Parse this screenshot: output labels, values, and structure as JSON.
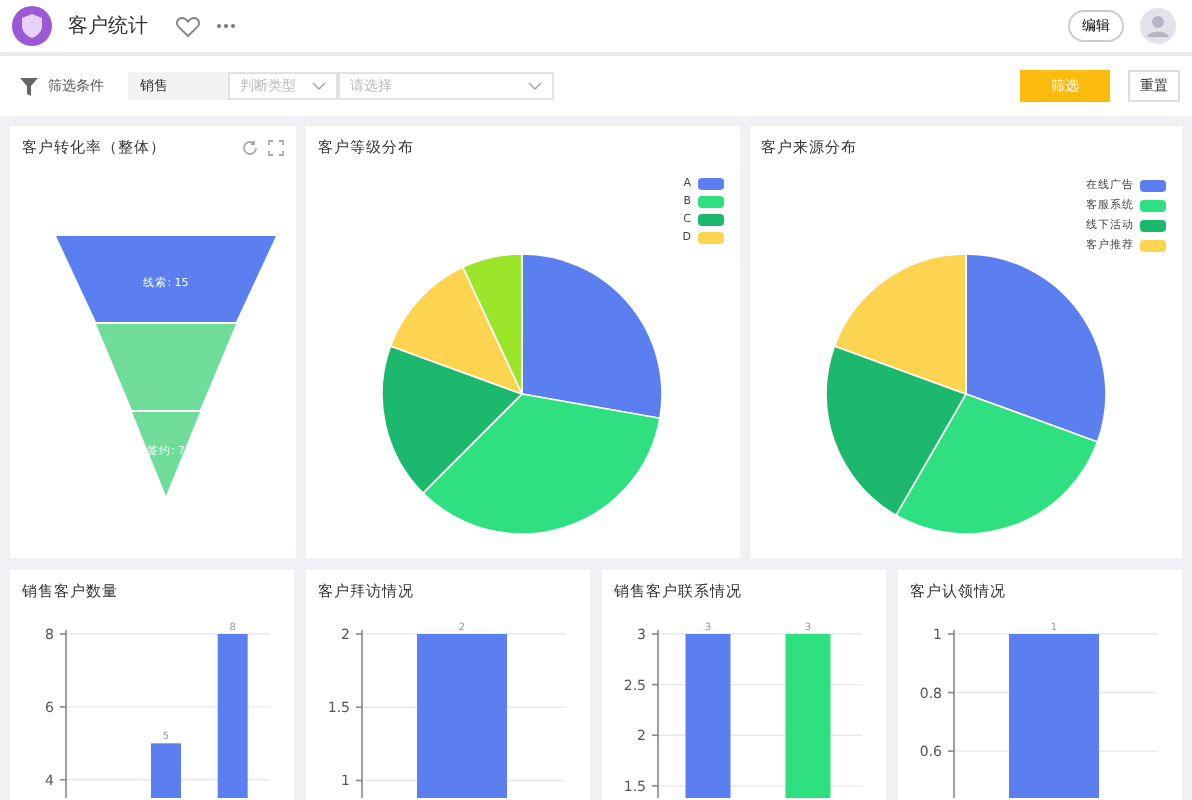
{
  "app": {
    "title": "客户统计",
    "edit_button": "编辑"
  },
  "filters": {
    "label": "筛选条件",
    "fields": [
      {
        "value": "销售"
      },
      {
        "placeholder": "判断类型"
      },
      {
        "placeholder": "请选择"
      }
    ],
    "buttons": [
      {
        "label": "筛选",
        "kind": "primary"
      },
      {
        "label": "重置",
        "kind": "default"
      }
    ]
  },
  "funnel_card": {
    "title": "客户转化率（整体）",
    "stages": [
      {
        "label": "线索: 15",
        "color": "#5b7ff0"
      },
      {
        "color": "#6fdc9a"
      },
      {
        "label": "签约: 7",
        "color": "#6fdc9a"
      }
    ]
  },
  "pie_cards": [
    {
      "title": "客户等级分布",
      "legend": [
        {
          "label": "A",
          "color": "#5b7ff0"
        },
        {
          "label": "B",
          "color": "#2ee07f"
        },
        {
          "label": "C",
          "color": "#1cb86e"
        },
        {
          "label": "D",
          "color": "#fdd44f"
        }
      ]
    },
    {
      "title": "客户来源分布",
      "legend": [
        {
          "label": "在线广告",
          "color": "#5b7ff0"
        },
        {
          "label": "客服系统",
          "color": "#2ee07f"
        },
        {
          "label": "线下活动",
          "color": "#1cb86e"
        },
        {
          "label": "客户推荐",
          "color": "#fdd44f"
        }
      ]
    }
  ],
  "bar_cards": [
    {
      "title": "销售客户数量",
      "chart_data": {
        "type": "bar",
        "values": [
          null,
          5,
          8
        ],
        "ylim": [
          3.5,
          8
        ],
        "grid": true,
        "yticks": [
          4,
          6,
          8
        ],
        "data_labels": true
      }
    },
    {
      "title": "客户拜访情况",
      "chart_data": {
        "type": "bar",
        "values": [
          2
        ],
        "ylim": [
          0.88,
          2
        ],
        "grid": true,
        "yticks": [
          1,
          {
            "value": 1.5,
            "label": "1.5"
          },
          2
        ],
        "data_labels": true
      }
    },
    {
      "title": "销售客户联系情况",
      "chart_data": {
        "type": "bar",
        "series": [
          {
            "color": "#5b7ff0",
            "values": [
              3,
              null
            ]
          },
          {
            "color": "#2ee07f",
            "values": [
              null,
              3
            ]
          }
        ],
        "ylim": [
          1.38,
          3
        ],
        "grid": true,
        "yticks": [
          {
            "value": 1.5,
            "label": "1.5"
          },
          2,
          {
            "value": 2.5,
            "label": "2.5"
          },
          3
        ],
        "data_labels": true
      }
    },
    {
      "title": "客户认领情况",
      "chart_data": {
        "type": "bar",
        "values": [
          1
        ],
        "ylim": [
          0.44,
          1
        ],
        "grid": true,
        "yticks": [
          {
            "value": 0.6,
            "label": "0.6"
          },
          {
            "value": 0.8,
            "label": "0.8"
          },
          1
        ],
        "data_labels": true
      }
    }
  ]
}
